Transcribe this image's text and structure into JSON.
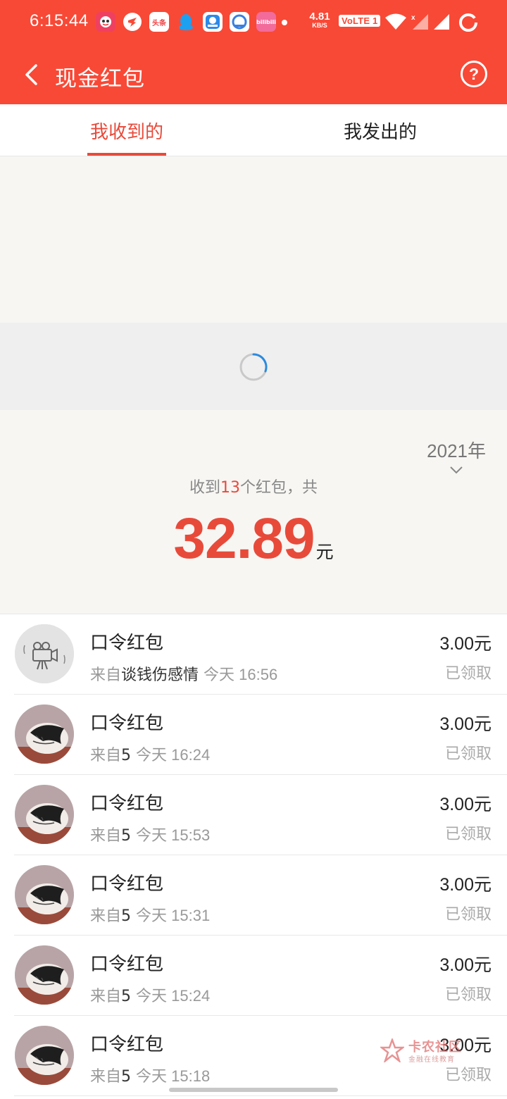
{
  "status_bar": {
    "time": "6:15:44",
    "app_icons": [
      {
        "name": "pinduoduo-icon",
        "label": "",
        "color": "#f04060"
      },
      {
        "name": "dingtalk-icon",
        "label": "",
        "color": "#ffffff"
      },
      {
        "name": "toutiao-icon",
        "label": "头条",
        "color": "#ffffff"
      },
      {
        "name": "qq-icon",
        "label": "",
        "color": "#1ea0f0"
      },
      {
        "name": "yunshanfu-icon",
        "label": "",
        "color": "#2c8ae8"
      },
      {
        "name": "browser-icon",
        "label": "",
        "color": "#3a7fe0"
      },
      {
        "name": "bilibili-icon",
        "label": "bilibili",
        "color": "#f26b9b"
      }
    ],
    "net_speed_value": "4.81",
    "net_speed_unit": "KB/S",
    "volte": "VoLTE 1"
  },
  "header": {
    "title": "现金红包",
    "back_icon": "chevron-left-icon",
    "help_label": "?"
  },
  "tabs": [
    {
      "label": "我收到的",
      "active": true
    },
    {
      "label": "我发出的",
      "active": false
    }
  ],
  "summary": {
    "year": "2021年",
    "prefix": "收到",
    "count": "13",
    "suffix": "个红包，共",
    "amount": "32.89",
    "unit": "元"
  },
  "packets": [
    {
      "title": "口令红包",
      "from_label": "来自",
      "sender": "谈钱伤感情",
      "time": "今天 16:56",
      "amount": "3.00元",
      "status": "已领取",
      "avatar": "camera-placeholder"
    },
    {
      "title": "口令红包",
      "from_label": "来自",
      "sender": "5",
      "time": "今天 16:24",
      "amount": "3.00元",
      "status": "已领取",
      "avatar": "photo"
    },
    {
      "title": "口令红包",
      "from_label": "来自",
      "sender": "5",
      "time": "今天 15:53",
      "amount": "3.00元",
      "status": "已领取",
      "avatar": "photo"
    },
    {
      "title": "口令红包",
      "from_label": "来自",
      "sender": "5",
      "time": "今天 15:31",
      "amount": "3.00元",
      "status": "已领取",
      "avatar": "photo"
    },
    {
      "title": "口令红包",
      "from_label": "来自",
      "sender": "5",
      "time": "今天 15:24",
      "amount": "3.00元",
      "status": "已领取",
      "avatar": "photo"
    },
    {
      "title": "口令红包",
      "from_label": "来自",
      "sender": "5",
      "time": "今天 15:18",
      "amount": "3.00元",
      "status": "已领取",
      "avatar": "photo"
    }
  ],
  "watermark": {
    "text": "卡农社区",
    "sub": "金融在线教育"
  },
  "colors": {
    "brand": "#f84936",
    "accent": "#e84a3a",
    "spinner": "#2a8be0"
  }
}
